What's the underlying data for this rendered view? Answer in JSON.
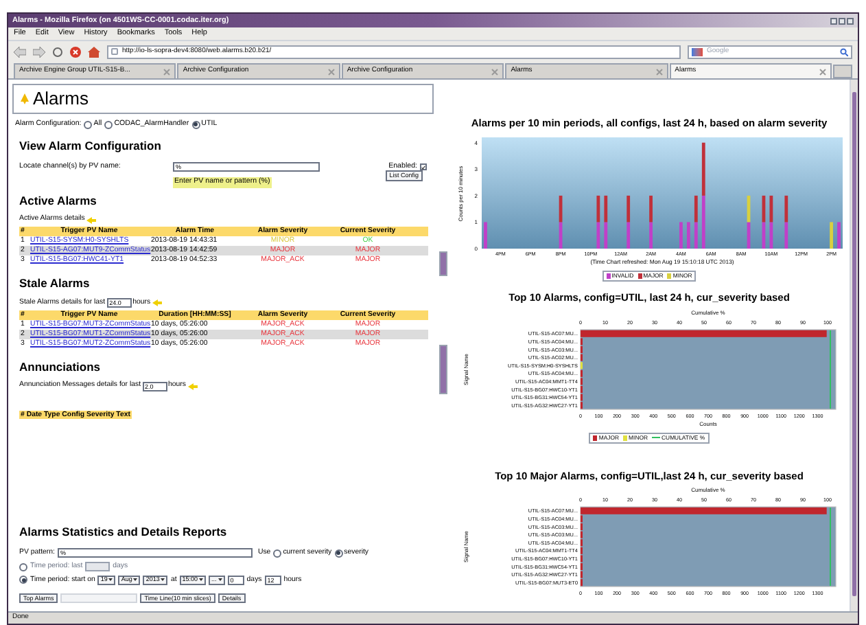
{
  "window": {
    "title": "Alarms - Mozilla Firefox (on 4501WS-CC-0001.codac.iter.org)"
  },
  "menu": [
    "File",
    "Edit",
    "View",
    "History",
    "Bookmarks",
    "Tools",
    "Help"
  ],
  "toolbar": {
    "address": "http://io-ls-sopra-dev4:8080/web.alarms.b20.b21/",
    "search_placeholder": "Google"
  },
  "tabs": [
    {
      "label": "Archive Engine Group UTIL-S15-B...",
      "selected": false
    },
    {
      "label": "Archive Configuration",
      "selected": false
    },
    {
      "label": "Archive Configuration",
      "selected": false
    },
    {
      "label": "Alarms",
      "selected": false
    },
    {
      "label": "Alarms",
      "selected": true
    }
  ],
  "page_title": "Alarms",
  "alarm_configuration": {
    "label": "Alarm Configuration:",
    "options": [
      {
        "label": "All",
        "selected": false
      },
      {
        "label": "CODAC_AlarmHandler",
        "selected": false
      },
      {
        "label": "UTIL",
        "selected": true
      }
    ]
  },
  "view_alarm_configuration": {
    "heading": "View Alarm Configuration",
    "locate_label": "Locate channel(s) by PV name:",
    "pv_value": "%",
    "hint": "Enter PV name or pattern (%)",
    "enabled_label": "Enabled:",
    "enabled_checked": true,
    "button": "List Config"
  },
  "active_alarms": {
    "heading": "Active Alarms",
    "details": "Active Alarms details",
    "columns": [
      "#",
      "Trigger PV Name",
      "Alarm Time",
      "Alarm Severity",
      "Current Severity"
    ],
    "rows": [
      {
        "number": "1",
        "pv": "UTIL-S15-SYSM:H0-SYSHLTS",
        "time": "2013-08-19 14:43:31",
        "alarm": {
          "text": "MINOR",
          "color": "#d8c83a"
        },
        "current": {
          "text": "OK",
          "color": "#3fd046"
        }
      },
      {
        "number": "2",
        "pv": "UTIL-S15-AG07:MUT9-ZCommStatus",
        "time": "2013-08-19 14:42:59",
        "alarm": {
          "text": "MAJOR",
          "color": "#e8343c"
        },
        "current": {
          "text": "MAJOR",
          "color": "#e8343c"
        }
      },
      {
        "number": "3",
        "pv": "UTIL-S15-BG07:HWC41-YT1",
        "time": "2013-08-19 04:52:33",
        "alarm": {
          "text": "MAJOR_ACK",
          "color": "#e8343c"
        },
        "current": {
          "text": "MAJOR",
          "color": "#e8343c"
        }
      }
    ]
  },
  "stale_alarms": {
    "heading": "Stale Alarms",
    "details": "Stale Alarms details for last",
    "hours_value": "24.0",
    "hours_label": "hours",
    "columns": [
      "#",
      "Trigger PV Name",
      "Duration [HH:MM:SS]",
      "Alarm Severity",
      "Current Severity"
    ],
    "rows": [
      {
        "number": "1",
        "pv": "UTIL-S15-BG07:MUT3-ZCommStatus",
        "time": "10 days, 05:26:00",
        "alarm": {
          "text": "MAJOR_ACK",
          "color": "#e8343c"
        },
        "current": {
          "text": "MAJOR",
          "color": "#e8343c"
        }
      },
      {
        "number": "2",
        "pv": "UTIL-S15-BG07:MUT1-ZCommStatus",
        "time": "10 days, 05:26:00",
        "alarm": {
          "text": "MAJOR_ACK",
          "color": "#e8343c"
        },
        "current": {
          "text": "MAJOR",
          "color": "#e8343c"
        }
      },
      {
        "number": "3",
        "pv": "UTIL-S15-BG07:MUT2-ZCommStatus",
        "time": "10 days, 05:26:00",
        "alarm": {
          "text": "MAJOR_ACK",
          "color": "#e8343c"
        },
        "current": {
          "text": "MAJOR",
          "color": "#e8343c"
        }
      }
    ]
  },
  "annunciations": {
    "heading": "Annunciations",
    "details": "Annunciation Messages details for last",
    "hours_value": "2.0",
    "hours_label": "hours",
    "header": "# Date Type Config Severity Text"
  },
  "reports": {
    "heading": "Alarms Statistics and Details Reports",
    "pv_label": "PV pattern:",
    "pv_value": "%",
    "use_label": "Use",
    "severity_options": [
      {
        "label": "current severity",
        "selected": false
      },
      {
        "label": "severity",
        "selected": true
      }
    ],
    "period_last": {
      "label": "Time period: last",
      "unit": "days",
      "selected": false
    },
    "period_start": {
      "label": "Time period: start on",
      "selected": true,
      "day": "19",
      "month": "Aug",
      "year": "2013",
      "at": "at",
      "time": "15:00",
      "minute": "...",
      "days_value": "0",
      "days_label": "days",
      "hours_value": "12",
      "hours_label": "hours"
    },
    "buttons": [
      {
        "label": "Top Alarms",
        "disabled": false
      },
      {
        "disabled": true
      },
      {
        "label": "Time Line(10 min slices)",
        "disabled": false
      },
      {
        "label": "Details",
        "disabled": false
      }
    ]
  },
  "charts": [
    {
      "note": "(Time Chart refreshed: Mon Aug 19 15:10:18 UTC 2013)",
      "chart_data": {
        "type": "bar",
        "title": "Alarms per 10 min periods, all configs, last 24 h, based on alarm severity",
        "ylabel": "Counts per 10 minutes",
        "stacked": true,
        "categories": [
          null,
          null,
          "4PM",
          null,
          null,
          null,
          "6PM",
          null,
          null,
          null,
          "8PM",
          null,
          null,
          null,
          "10PM",
          null,
          null,
          null,
          "12AM",
          null,
          null,
          null,
          "2AM",
          null,
          null,
          null,
          "4AM",
          null,
          null,
          null,
          "6AM",
          null,
          null,
          null,
          "8AM",
          null,
          null,
          null,
          "10AM",
          null,
          null,
          null,
          "12PM",
          null,
          null,
          null,
          "2PM",
          null
        ],
        "series": [
          {
            "name": "INVALID",
            "color": "#c040c8",
            "values": [
              1,
              0,
              0,
              0,
              0,
              0,
              0,
              0,
              0,
              0,
              1,
              0,
              0,
              0,
              0,
              1,
              1,
              0,
              0,
              1,
              0,
              0,
              1,
              0,
              0,
              0,
              1,
              1,
              1,
              2,
              0,
              0,
              0,
              0,
              0,
              1,
              0,
              1,
              1,
              0,
              1,
              0,
              0,
              0,
              0,
              0,
              0,
              1
            ]
          },
          {
            "name": "MAJOR",
            "color": "#c0303a",
            "values": [
              0,
              0,
              0,
              0,
              0,
              0,
              0,
              0,
              0,
              0,
              1,
              0,
              0,
              0,
              0,
              1,
              1,
              0,
              0,
              1,
              0,
              0,
              1,
              0,
              0,
              0,
              0,
              0,
              1,
              2,
              0,
              0,
              0,
              0,
              0,
              0,
              0,
              1,
              1,
              0,
              1,
              0,
              0,
              0,
              0,
              0,
              0,
              0
            ]
          },
          {
            "name": "MINOR",
            "color": "#d8d040",
            "values": [
              0,
              0,
              0,
              0,
              0,
              0,
              0,
              0,
              0,
              0,
              0,
              0,
              0,
              0,
              0,
              0,
              0,
              0,
              0,
              0,
              0,
              0,
              0,
              0,
              0,
              0,
              0,
              0,
              0,
              0,
              0,
              0,
              0,
              0,
              0,
              1,
              0,
              0,
              0,
              0,
              0,
              0,
              0,
              0,
              0,
              0,
              1,
              0
            ]
          }
        ],
        "ylim": [
          0,
          4.2
        ],
        "yticks": [
          0,
          1,
          2,
          3,
          4
        ]
      }
    },
    {
      "top_axis": {
        "label": "Cumulative %",
        "ticks": [
          "0",
          "10",
          "20",
          "30",
          "40",
          "50",
          "60",
          "70",
          "80",
          "90",
          "100"
        ]
      },
      "chart_data": {
        "type": "bar",
        "orientation": "horizontal",
        "title": "Top 10 Alarms, config=UTIL, last 24 h,  cur_severity based",
        "xlabel": "Counts",
        "ylabel": "Signal Name",
        "ref_lines": [
          {
            "axis": "x",
            "value": 1370,
            "label": "CUMULATIVE %",
            "color": "#30c060"
          }
        ],
        "categories": [
          "UTIL-S15-AC07:MU...",
          "UTIL-S15-AC04:MU...",
          "UTIL-S15-AC03:MU...",
          "UTIL-S15-AC02:MU...",
          "UTIL-S15-SYSM:H0-SYSHLTS",
          "UTIL-S15-AC04:MU...",
          "UTIL-S15-AC04:MMT1-TT4",
          "UTIL-S15-BG07:HWC10-YT1",
          "UTIL-S15-BG31:HWC54-YT1",
          "UTIL-S15-AG32:HWC27-YT1"
        ],
        "series": [
          {
            "name": "MAJOR",
            "color": "#c0262d",
            "values": [
              1350,
              8,
              8,
              8,
              0,
              8,
              8,
              8,
              8,
              8
            ]
          },
          {
            "name": "MINOR",
            "color": "#e0e040",
            "values": [
              0,
              0,
              0,
              0,
              8,
              0,
              0,
              0,
              0,
              0
            ]
          }
        ],
        "xlim": [
          0,
          1400
        ],
        "xticks": [
          0,
          100,
          200,
          300,
          400,
          500,
          600,
          700,
          800,
          900,
          1000,
          1100,
          1200,
          1300
        ]
      }
    },
    {
      "top_axis": {
        "label": "Cumulative %",
        "ticks": [
          "0",
          "10",
          "20",
          "30",
          "40",
          "50",
          "60",
          "70",
          "80",
          "90",
          "100"
        ]
      },
      "chart_data": {
        "type": "bar",
        "orientation": "horizontal",
        "title": "Top 10 Major Alarms, config=UTIL,last 24 h,  cur_severity based",
        "ylabel": "Signal Name",
        "ref_lines": [
          {
            "axis": "x",
            "value": 1370,
            "color": "#30c060"
          }
        ],
        "categories": [
          "UTIL-S15-AC07:MU...",
          "UTIL-S15-AC04:MU...",
          "UTIL-S15-AC03:MU...",
          "UTIL-S15-AC03:MU...",
          "UTIL-S15-AC04:MU...",
          "UTIL-S15-AC04:MMT1-TT4",
          "UTIL-S15-BG07:HWC10-YT1",
          "UTIL-S15-BG31:HWC54-YT1",
          "UTIL-S15-AG32:HWC27-YT1",
          "UTIL-S15-BG07:MUT3-ET0"
        ],
        "series": [
          {
            "color": "#c0262d",
            "values": [
              1350,
              8,
              8,
              8,
              8,
              8,
              8,
              8,
              8,
              8
            ]
          }
        ],
        "xlim": [
          0,
          1400
        ],
        "xticks": [
          0,
          100,
          200,
          300,
          400,
          500,
          600,
          700,
          800,
          900,
          1000,
          1100,
          1200,
          1300
        ]
      }
    }
  ],
  "status_bar": "Done"
}
